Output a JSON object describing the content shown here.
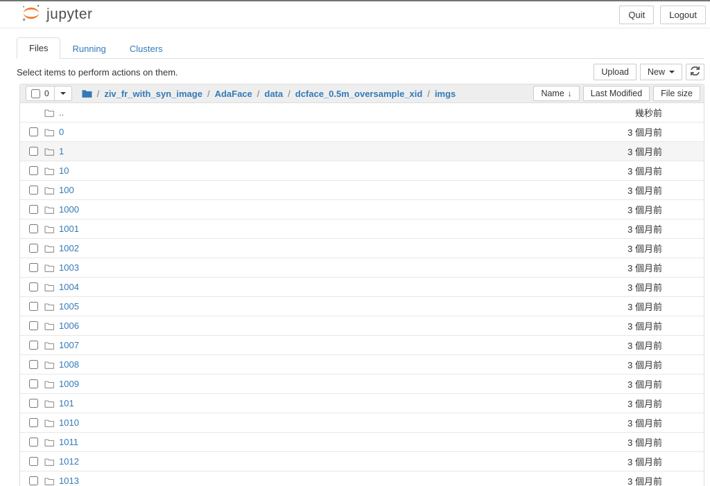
{
  "header": {
    "logo_text": "jupyter",
    "quit_label": "Quit",
    "logout_label": "Logout"
  },
  "tabs": [
    {
      "label": "Files",
      "active": true
    },
    {
      "label": "Running",
      "active": false
    },
    {
      "label": "Clusters",
      "active": false
    }
  ],
  "toolbar": {
    "hint": "Select items to perform actions on them.",
    "upload_label": "Upload",
    "new_label": "New"
  },
  "list_header": {
    "selected_count": "0",
    "breadcrumb": [
      "ziv_fr_with_syn_image",
      "AdaFace",
      "data",
      "dcface_0.5m_oversample_xid",
      "imgs"
    ],
    "sort_name_label": "Name",
    "sort_name_arrow": "↓",
    "last_modified_label": "Last Modified",
    "file_size_label": "File size"
  },
  "colors": {
    "link_blue": "#337ab7",
    "logo_orange": "#f37726",
    "list_header_bg": "#eeeeee",
    "highlight_row_bg": "#f5f5f5",
    "border": "#dddddd"
  },
  "rows": [
    {
      "name": "..",
      "modified": "幾秒前",
      "checkbox": false,
      "highlighted": false
    },
    {
      "name": "0",
      "modified": "3 個月前",
      "checkbox": true,
      "highlighted": false
    },
    {
      "name": "1",
      "modified": "3 個月前",
      "checkbox": true,
      "highlighted": true
    },
    {
      "name": "10",
      "modified": "3 個月前",
      "checkbox": true,
      "highlighted": false
    },
    {
      "name": "100",
      "modified": "3 個月前",
      "checkbox": true,
      "highlighted": false
    },
    {
      "name": "1000",
      "modified": "3 個月前",
      "checkbox": true,
      "highlighted": false
    },
    {
      "name": "1001",
      "modified": "3 個月前",
      "checkbox": true,
      "highlighted": false
    },
    {
      "name": "1002",
      "modified": "3 個月前",
      "checkbox": true,
      "highlighted": false
    },
    {
      "name": "1003",
      "modified": "3 個月前",
      "checkbox": true,
      "highlighted": false
    },
    {
      "name": "1004",
      "modified": "3 個月前",
      "checkbox": true,
      "highlighted": false
    },
    {
      "name": "1005",
      "modified": "3 個月前",
      "checkbox": true,
      "highlighted": false
    },
    {
      "name": "1006",
      "modified": "3 個月前",
      "checkbox": true,
      "highlighted": false
    },
    {
      "name": "1007",
      "modified": "3 個月前",
      "checkbox": true,
      "highlighted": false
    },
    {
      "name": "1008",
      "modified": "3 個月前",
      "checkbox": true,
      "highlighted": false
    },
    {
      "name": "1009",
      "modified": "3 個月前",
      "checkbox": true,
      "highlighted": false
    },
    {
      "name": "101",
      "modified": "3 個月前",
      "checkbox": true,
      "highlighted": false
    },
    {
      "name": "1010",
      "modified": "3 個月前",
      "checkbox": true,
      "highlighted": false
    },
    {
      "name": "1011",
      "modified": "3 個月前",
      "checkbox": true,
      "highlighted": false
    },
    {
      "name": "1012",
      "modified": "3 個月前",
      "checkbox": true,
      "highlighted": false
    },
    {
      "name": "1013",
      "modified": "3 個月前",
      "checkbox": true,
      "highlighted": false
    }
  ]
}
